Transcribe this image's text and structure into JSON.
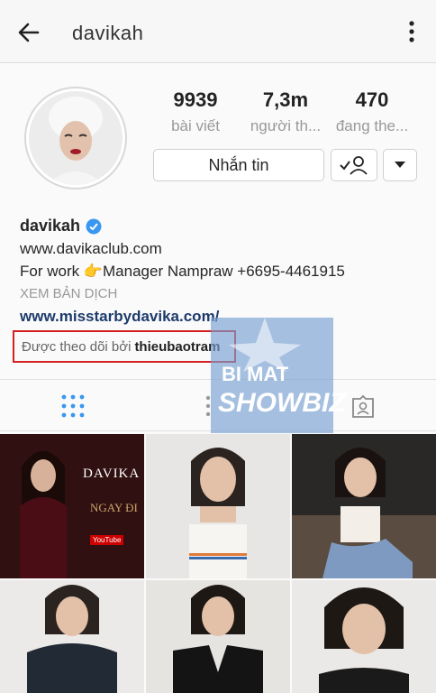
{
  "header": {
    "title": "davikah"
  },
  "stats": [
    {
      "value": "9939",
      "label": "bài viết"
    },
    {
      "value": "7,3m",
      "label": "người th..."
    },
    {
      "value": "470",
      "label": "đang the..."
    }
  ],
  "actions": {
    "message_label": "Nhắn tin"
  },
  "bio": {
    "username": "davikah",
    "website": "www.davikaclub.com",
    "work_line": "For work 👉Manager Nampraw +6695-4461915",
    "translate_label": "XEM BẢN DỊCH",
    "link2": "www.misstarbydavika.com/"
  },
  "followed_by": {
    "prefix": "Được theo dõi bởi",
    "user": "thieubaotram"
  },
  "watermark": {
    "line1": "BI MAT",
    "line2": "SHOWBIZ"
  },
  "posts": [
    {
      "caption_top": "DAVIKA",
      "caption_bottom": "NGAY ĐI",
      "caption_small": "YouTube"
    },
    {},
    {},
    {},
    {},
    {}
  ],
  "colors": {
    "accent": "#3897f0",
    "highlight_border": "#d42020",
    "link": "#1d3b6c"
  }
}
